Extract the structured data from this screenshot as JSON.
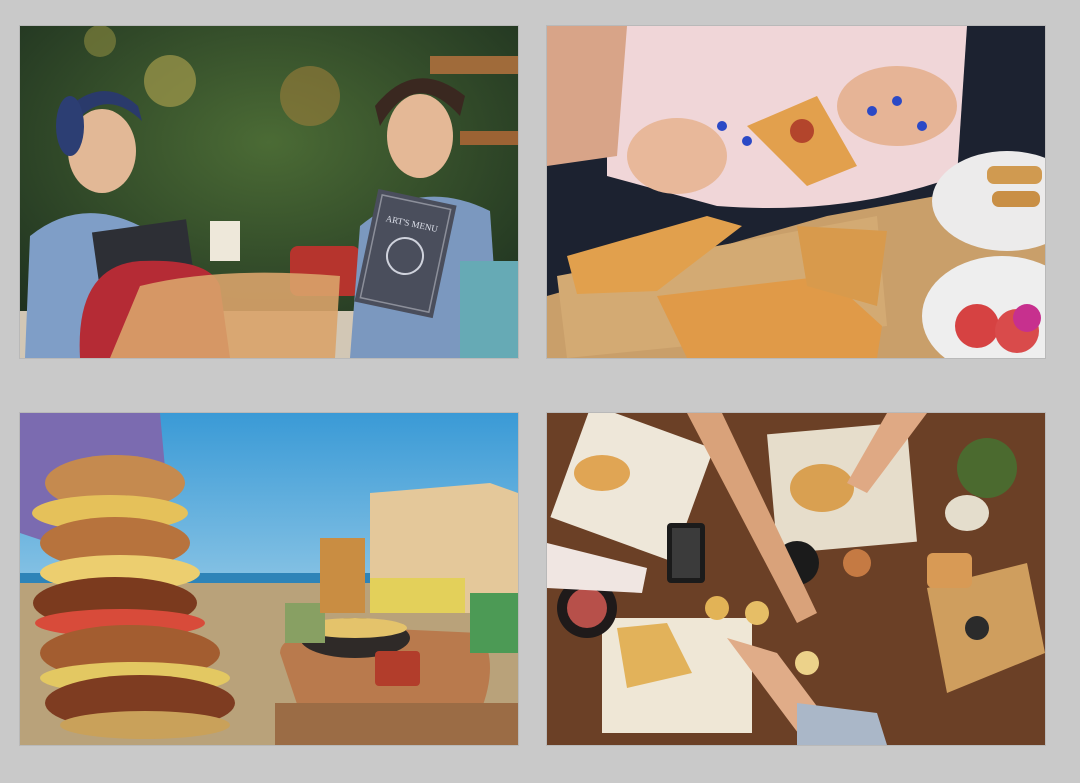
{
  "collage": {
    "background_color": "#c9c9c9",
    "photos": [
      {
        "id": "cafe-women-with-menus",
        "dominant_colors": [
          "#2f4a2a",
          "#7a94b8",
          "#b52b35"
        ]
      },
      {
        "id": "hand-tearing-pastry",
        "dominant_colors": [
          "#1c2230",
          "#e3a04e",
          "#d9a66a"
        ]
      },
      {
        "id": "burger-stack-at-beach",
        "dominant_colors": [
          "#4aa6d8",
          "#b0804c",
          "#7b3a1e"
        ]
      },
      {
        "id": "overhead-food-table",
        "dominant_colors": [
          "#6b4026",
          "#d89a55",
          "#1b1b1b"
        ]
      }
    ]
  },
  "menu_cover_text": "ART'S MENU"
}
